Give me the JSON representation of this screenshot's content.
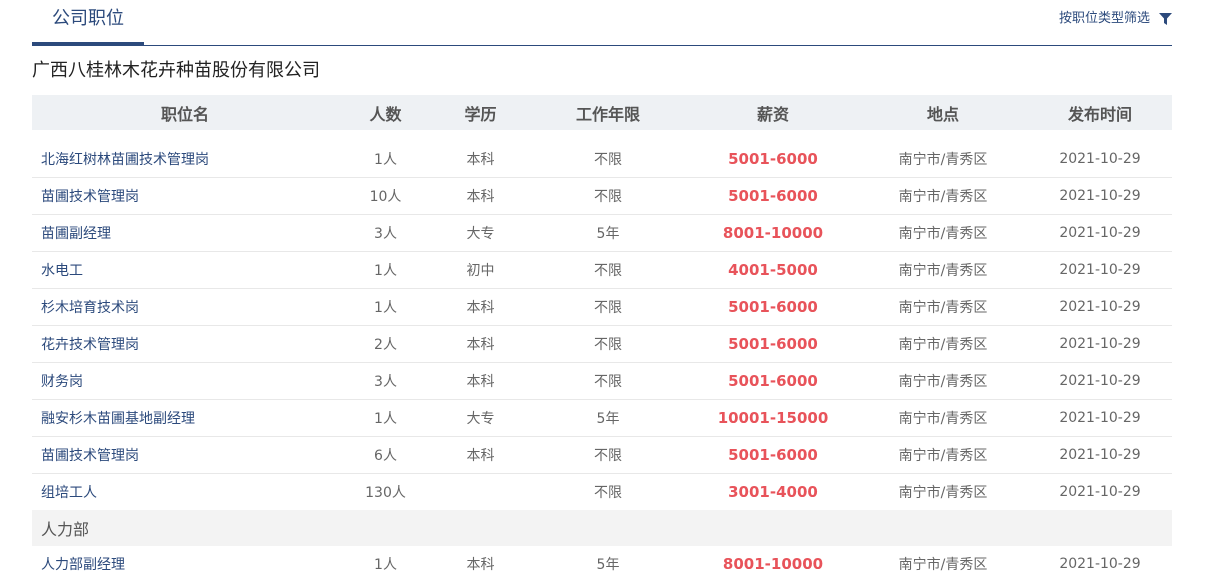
{
  "header": {
    "tab_label": "公司职位",
    "filter_label": "按职位类型筛选",
    "filter_icon": "filter-icon",
    "accent_color": "#2c4a7c"
  },
  "company_name": "广西八桂林木花卉种苗股份有限公司",
  "table": {
    "columns": [
      "职位名",
      "人数",
      "学历",
      "工作年限",
      "薪资",
      "地点",
      "发布时间"
    ],
    "rows": [
      {
        "title": "北海红树林苗圃技术管理岗",
        "count": "1人",
        "education": "本科",
        "experience": "不限",
        "salary": "5001-6000",
        "location": "南宁市/青秀区",
        "date": "2021-10-29"
      },
      {
        "title": "苗圃技术管理岗",
        "count": "10人",
        "education": "本科",
        "experience": "不限",
        "salary": "5001-6000",
        "location": "南宁市/青秀区",
        "date": "2021-10-29"
      },
      {
        "title": "苗圃副经理",
        "count": "3人",
        "education": "大专",
        "experience": "5年",
        "salary": "8001-10000",
        "location": "南宁市/青秀区",
        "date": "2021-10-29"
      },
      {
        "title": "水电工",
        "count": "1人",
        "education": "初中",
        "experience": "不限",
        "salary": "4001-5000",
        "location": "南宁市/青秀区",
        "date": "2021-10-29"
      },
      {
        "title": "杉木培育技术岗",
        "count": "1人",
        "education": "本科",
        "experience": "不限",
        "salary": "5001-6000",
        "location": "南宁市/青秀区",
        "date": "2021-10-29"
      },
      {
        "title": "花卉技术管理岗",
        "count": "2人",
        "education": "本科",
        "experience": "不限",
        "salary": "5001-6000",
        "location": "南宁市/青秀区",
        "date": "2021-10-29"
      },
      {
        "title": "财务岗",
        "count": "3人",
        "education": "本科",
        "experience": "不限",
        "salary": "5001-6000",
        "location": "南宁市/青秀区",
        "date": "2021-10-29"
      },
      {
        "title": "融安杉木苗圃基地副经理",
        "count": "1人",
        "education": "大专",
        "experience": "5年",
        "salary": "10001-15000",
        "location": "南宁市/青秀区",
        "date": "2021-10-29"
      },
      {
        "title": "苗圃技术管理岗",
        "count": "6人",
        "education": "本科",
        "experience": "不限",
        "salary": "5001-6000",
        "location": "南宁市/青秀区",
        "date": "2021-10-29"
      },
      {
        "title": "组培工人",
        "count": "130人",
        "education": "",
        "experience": "不限",
        "salary": "3001-4000",
        "location": "南宁市/青秀区",
        "date": "2021-10-29"
      }
    ],
    "section": {
      "label": "人力部",
      "rows": [
        {
          "title": "人力部副经理",
          "count": "1人",
          "education": "本科",
          "experience": "5年",
          "salary": "8001-10000",
          "location": "南宁市/青秀区",
          "date": "2021-10-29"
        }
      ]
    }
  },
  "salary_color": "#e8535a"
}
